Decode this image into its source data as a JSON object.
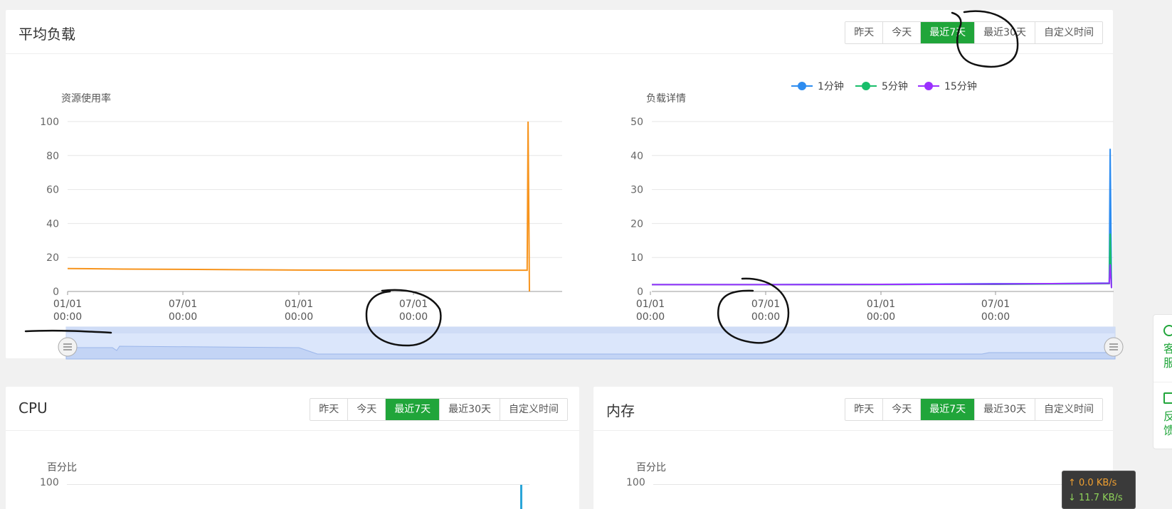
{
  "time_tabs": [
    "昨天",
    "今天",
    "最近7天",
    "最近30天",
    "自定义时间"
  ],
  "active_tab": 2,
  "load_panel": {
    "title": "平均负载",
    "resource_chart": {
      "ylabel": "资源使用率",
      "y_ticks": [
        "0",
        "20",
        "40",
        "60",
        "80",
        "100"
      ],
      "x_ticks": [
        {
          "date": "01/01",
          "time": "00:00"
        },
        {
          "date": "07/01",
          "time": "00:00"
        },
        {
          "date": "01/01",
          "time": "00:00"
        },
        {
          "date": "07/01",
          "time": "00:00"
        }
      ],
      "color": "#f7941d"
    },
    "load_chart": {
      "ylabel": "负载详情",
      "y_ticks": [
        "0",
        "10",
        "20",
        "30",
        "40",
        "50"
      ],
      "x_ticks": [
        {
          "date": "01/01",
          "time": "00:00"
        },
        {
          "date": "07/01",
          "time": "00:00"
        },
        {
          "date": "01/01",
          "time": "00:00"
        },
        {
          "date": "07/01",
          "time": "00:00"
        }
      ],
      "legend": [
        {
          "name": "1分钟",
          "color": "#2d8cf0"
        },
        {
          "name": "5分钟",
          "color": "#19be6b"
        },
        {
          "name": "15分钟",
          "color": "#9b30ff"
        }
      ]
    }
  },
  "cpu_panel": {
    "title": "CPU",
    "ylabel": "百分比",
    "y_top": "100"
  },
  "mem_panel": {
    "title": "内存",
    "ylabel": "百分比",
    "y_top": "100"
  },
  "side_widget": {
    "service": [
      "客",
      "服"
    ],
    "feedback": [
      "反",
      "馈"
    ]
  },
  "net_speed": {
    "up": "↑ 0.0 KB/s",
    "down": "↓ 11.7 KB/s"
  },
  "chart_data": [
    {
      "type": "line",
      "ylabel": "资源使用率",
      "ylim": [
        0,
        100
      ],
      "x_ticks": [
        "01/01 00:00",
        "07/01 00:00",
        "01/01 00:00",
        "07/01 00:00"
      ],
      "series": [
        {
          "values": [
            13.5,
            13.2,
            13,
            12.8,
            12.6,
            12.5,
            12.5,
            12.5,
            12.5,
            100,
            0
          ]
        }
      ]
    },
    {
      "type": "line",
      "ylabel": "负载详情",
      "ylim": [
        0,
        50
      ],
      "x_ticks": [
        "01/01 00:00",
        "07/01 00:00",
        "01/01 00:00",
        "07/01 00:00"
      ],
      "legend": "top-right",
      "series": [
        {
          "name": "1分钟",
          "values": [
            2,
            2,
            2,
            2.1,
            2.1,
            2.2,
            2.3,
            2.3,
            2.5,
            42,
            1
          ]
        },
        {
          "name": "5分钟",
          "values": [
            2,
            2,
            2,
            2,
            2,
            2.1,
            2.1,
            2.2,
            2.3,
            17,
            1
          ]
        },
        {
          "name": "15分钟",
          "values": [
            2,
            2,
            2,
            2,
            2.1,
            2.1,
            2.2,
            2.3,
            2.4,
            8,
            1
          ]
        }
      ]
    }
  ]
}
